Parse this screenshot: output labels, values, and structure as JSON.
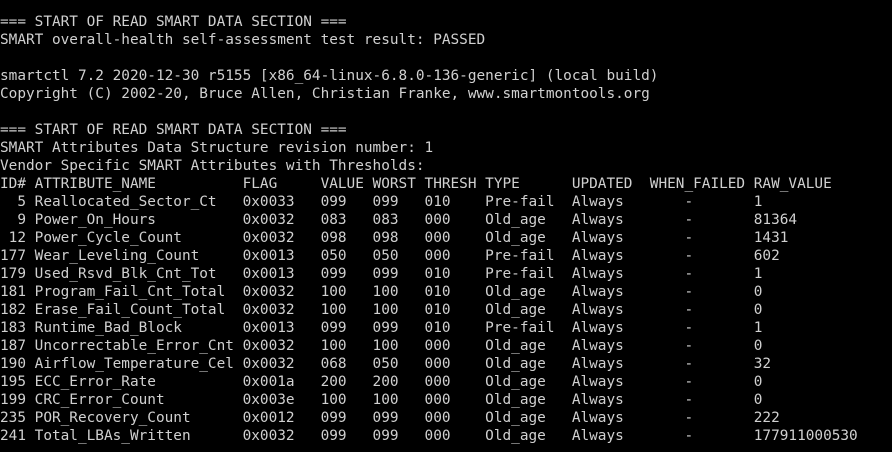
{
  "terminal": {
    "lines": [
      "=== START OF READ SMART DATA SECTION ===",
      "SMART overall-health self-assessment test result: PASSED",
      "",
      "smartctl 7.2 2020-12-30 r5155 [x86_64-linux-6.8.0-136-generic] (local build)",
      "Copyright (C) 2002-20, Bruce Allen, Christian Franke, www.smartmontools.org",
      "",
      "=== START OF READ SMART DATA SECTION ===",
      "SMART Attributes Data Structure revision number: 1",
      "Vendor Specific SMART Attributes with Thresholds:",
      "ID# ATTRIBUTE_NAME          FLAG     VALUE WORST THRESH TYPE      UPDATED  WHEN_FAILED RAW_VALUE",
      "  5 Reallocated_Sector_Ct   0x0033   099   099   010    Pre-fail  Always       -       1",
      "  9 Power_On_Hours          0x0032   083   083   000    Old_age   Always       -       81364",
      " 12 Power_Cycle_Count       0x0032   098   098   000    Old_age   Always       -       1431",
      "177 Wear_Leveling_Count     0x0013   050   050   000    Pre-fail  Always       -       602",
      "179 Used_Rsvd_Blk_Cnt_Tot   0x0013   099   099   010    Pre-fail  Always       -       1",
      "181 Program_Fail_Cnt_Total  0x0032   100   100   010    Old_age   Always       -       0",
      "182 Erase_Fail_Count_Total  0x0032   100   100   010    Old_age   Always       -       0",
      "183 Runtime_Bad_Block       0x0013   099   099   010    Pre-fail  Always       -       1",
      "187 Uncorrectable_Error_Cnt 0x0032   100   100   000    Old_age   Always       -       0",
      "190 Airflow_Temperature_Cel 0x0032   068   050   000    Old_age   Always       -       32",
      "195 ECC_Error_Rate          0x001a   200   200   000    Old_age   Always       -       0",
      "199 CRC_Error_Count         0x003e   100   100   000    Old_age   Always       -       0",
      "235 POR_Recovery_Count      0x0012   099   099   000    Old_age   Always       -       222",
      "241 Total_LBAs_Written      0x0032   099   099   000    Old_age   Always       -       177911000530"
    ]
  }
}
